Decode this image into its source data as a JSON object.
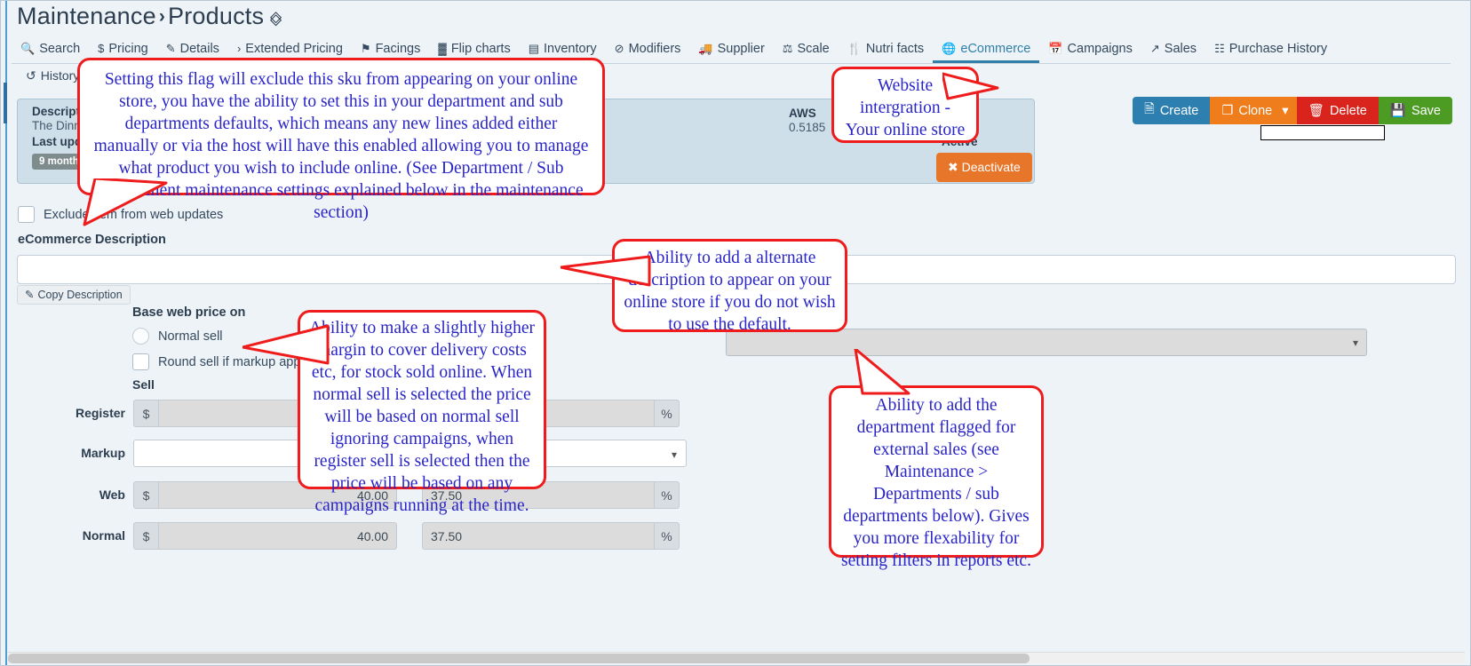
{
  "header": {
    "breadcrumb_root": "Maintenance",
    "breadcrumb_sep": "›",
    "breadcrumb_page": "Products",
    "pin_icon": "pin-icon"
  },
  "tabs": [
    {
      "label": "Search",
      "icon": "🔍",
      "icon_name": "search-icon",
      "active": false
    },
    {
      "label": "Pricing",
      "icon": "$",
      "icon_name": "dollar-icon",
      "active": false
    },
    {
      "label": "Details",
      "icon": "✎",
      "icon_name": "edit-square-icon",
      "active": false
    },
    {
      "label": "Extended Pricing",
      "icon": "›",
      "icon_name": "chevron-right-icon",
      "active": false
    },
    {
      "label": "Facings",
      "icon": "⚑",
      "icon_name": "tag-icon",
      "active": false
    },
    {
      "label": "Flip charts",
      "icon": "▓",
      "icon_name": "grid-icon",
      "active": false
    },
    {
      "label": "Inventory",
      "icon": "▤",
      "icon_name": "archive-box-icon",
      "active": false
    },
    {
      "label": "Modifiers",
      "icon": "⊘",
      "icon_name": "check-circle-icon",
      "active": false
    },
    {
      "label": "Supplier",
      "icon": "🚚",
      "icon_name": "truck-icon",
      "active": false
    },
    {
      "label": "Scale",
      "icon": "⚖",
      "icon_name": "scale-icon",
      "active": false
    },
    {
      "label": "Nutri facts",
      "icon": "🍴",
      "icon_name": "cutlery-icon",
      "active": false
    },
    {
      "label": "eCommerce",
      "icon": "🌐",
      "icon_name": "globe-icon",
      "active": true
    },
    {
      "label": "Campaigns",
      "icon": "📅",
      "icon_name": "calendar-icon",
      "active": false
    },
    {
      "label": "Sales",
      "icon": "↗",
      "icon_name": "chart-line-icon",
      "active": false
    },
    {
      "label": "Purchase History",
      "icon": "☷",
      "icon_name": "purchase-history-icon",
      "active": false
    }
  ],
  "history": {
    "label": "History",
    "icon": "↺",
    "icon_name": "history-clock-icon"
  },
  "info_panel": {
    "description_label": "Description",
    "description_value": "The Dinn",
    "last_updated_label": "Last updated",
    "last_updated_badge": "9 months",
    "aws_label": "AWS",
    "aws_value": "0.5185",
    "status_label": "Active",
    "deactivate_label": "Deactivate",
    "deactivate_icon": "✖"
  },
  "actions": {
    "create_label": "Create",
    "create_icon": "📄",
    "clone_label": "Clone",
    "clone_icon": "❐",
    "clone_caret": "▾",
    "delete_label": "Delete",
    "delete_icon": "🗑",
    "save_label": "Save",
    "save_icon": "💾",
    "create_color": "#2d7fb0",
    "clone_color": "#ef7d1b",
    "delete_color": "#d9241e",
    "save_color": "#4c9c23"
  },
  "form": {
    "exclude_label": "Exclude item from web updates",
    "exclude_checked": false,
    "ecommerce_description_label": "eCommerce Description",
    "ecommerce_description_value": "",
    "copy_description_label": "Copy Description",
    "copy_description_icon": "✎",
    "base_web_price_label": "Base web price on",
    "normal_sell_label": "Normal sell",
    "round_sell_label": "Round sell if markup applied",
    "department_value": "",
    "select_caret": "▾",
    "sell_header": "Sell",
    "currency_symbol": "$",
    "percent_symbol": "%"
  },
  "price_rows": [
    {
      "label": "Register",
      "sell": "",
      "pct": "",
      "type": "normal"
    },
    {
      "label": "Markup",
      "sell": "",
      "pct": "",
      "type": "markup"
    },
    {
      "label": "Web",
      "sell": "40.00",
      "pct": "37.50",
      "type": "normal"
    },
    {
      "label": "Normal",
      "sell": "40.00",
      "pct": "37.50",
      "type": "normal"
    }
  ],
  "callouts": {
    "exclude_flag": "Setting this flag will exclude this sku from appearing on your online store, you have the ability to set this in your department and sub departments defaults, which means any new lines added either manually or via the host will have this enabled allowing you to manage what product you wish to include online.  (See Department / Sub Department maintenance settings explained below in the maintenance section)",
    "website_integration": "Website intergration - Your online store",
    "alternate_description": "Ability to add a alternate description to appear on your online store if you do not wish to use the default.",
    "markup_explain": "Ability to make a slightly higher margin to cover delivery costs etc, for stock sold online.  When normal sell is selected the price will be based on normal sell ignoring campaigns, when register sell is selected then the price will be based on any campaigns running at the time.",
    "department_explain": "Ability to add the department flagged for external sales (see Maintenance > Departments / sub departments below). Gives you more flexability for setting filters in reports etc."
  },
  "colors": {
    "callout_border": "#ee1c1c",
    "callout_text": "#2a25c6",
    "accent": "#2f7fa8"
  }
}
